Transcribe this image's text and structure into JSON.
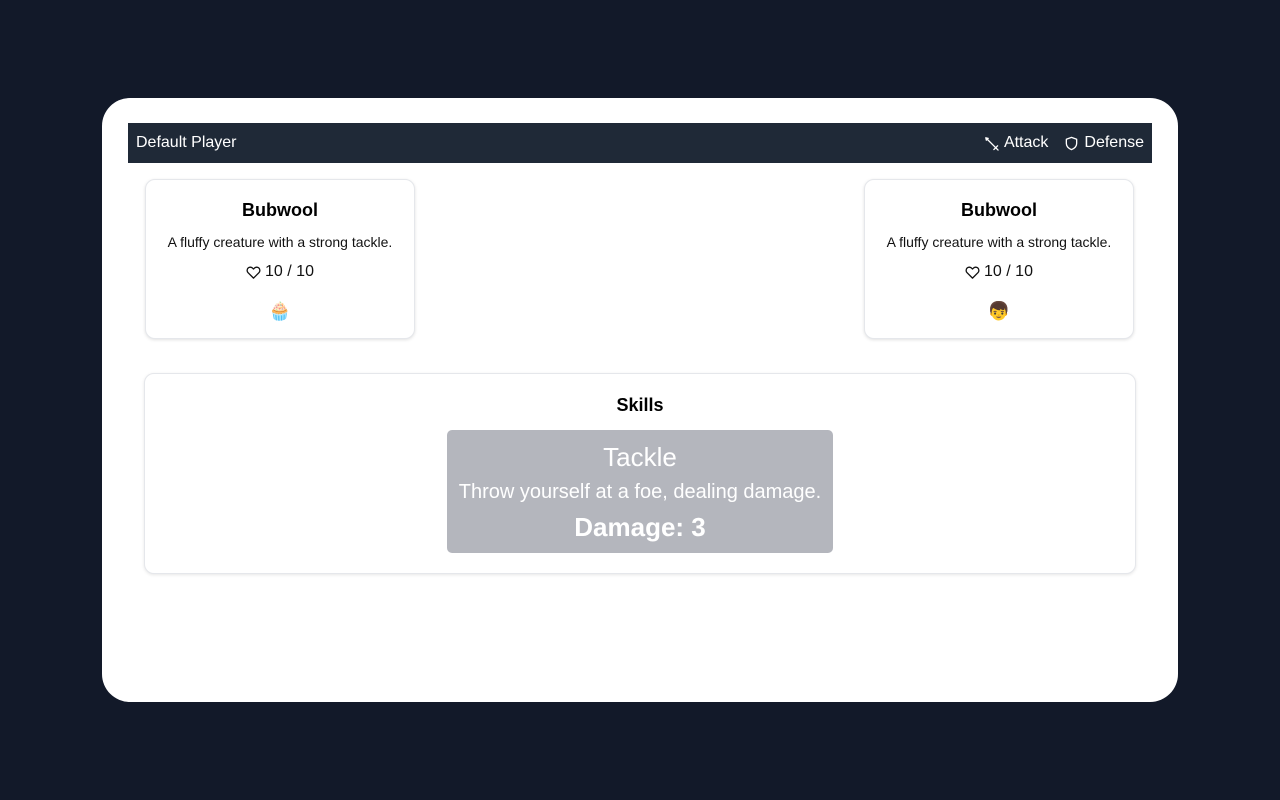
{
  "player": {
    "name": "Default Player"
  },
  "actions": {
    "attack_label": "Attack",
    "defense_label": "Defense",
    "attack_icon": "sword-icon",
    "defense_icon": "shield-icon"
  },
  "creatures": {
    "player": {
      "name": "Bubwool",
      "description": "A fluffy creature with a strong tackle.",
      "hp": "10 / 10",
      "sprite": "🧁"
    },
    "opponent": {
      "name": "Bubwool",
      "description": "A fluffy creature with a strong tackle.",
      "hp": "10 / 10",
      "sprite": "👦"
    }
  },
  "skills": {
    "title": "Skills",
    "items": [
      {
        "name": "Tackle",
        "description": "Throw yourself at a foe, dealing damage.",
        "damage_label": "Damage: 3"
      }
    ]
  },
  "colors": {
    "background": "#121929",
    "topbar": "#1f2937",
    "skill_card": "#b4b6bd"
  }
}
